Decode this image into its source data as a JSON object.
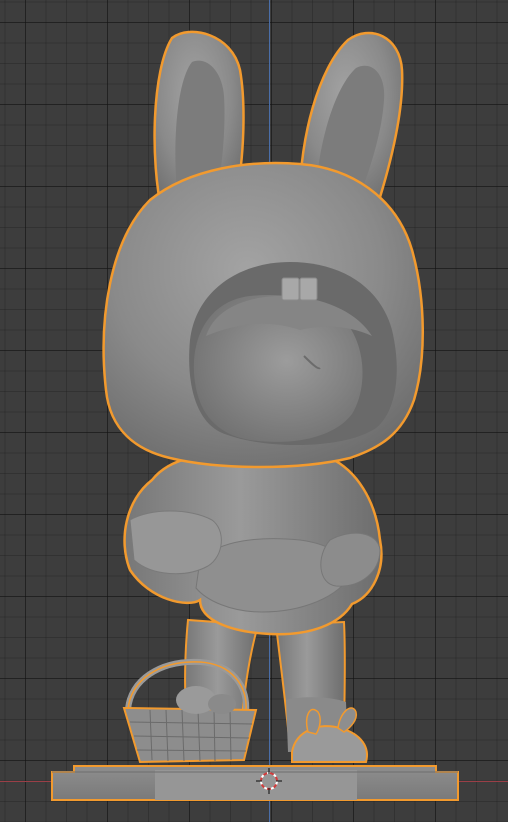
{
  "viewport": {
    "background_color": "#3d3d3d",
    "grid_color": "#2f2f2f",
    "axis_x_color": "#9a3f47",
    "axis_z_color": "#4a6ea8",
    "selection_outline_color": "#f29a2e",
    "mesh_color": "#8c8c8c"
  },
  "model": {
    "selected": true,
    "subject": "bunny-hood-figure"
  },
  "cursor": {
    "icon": "3d-cursor-icon"
  }
}
